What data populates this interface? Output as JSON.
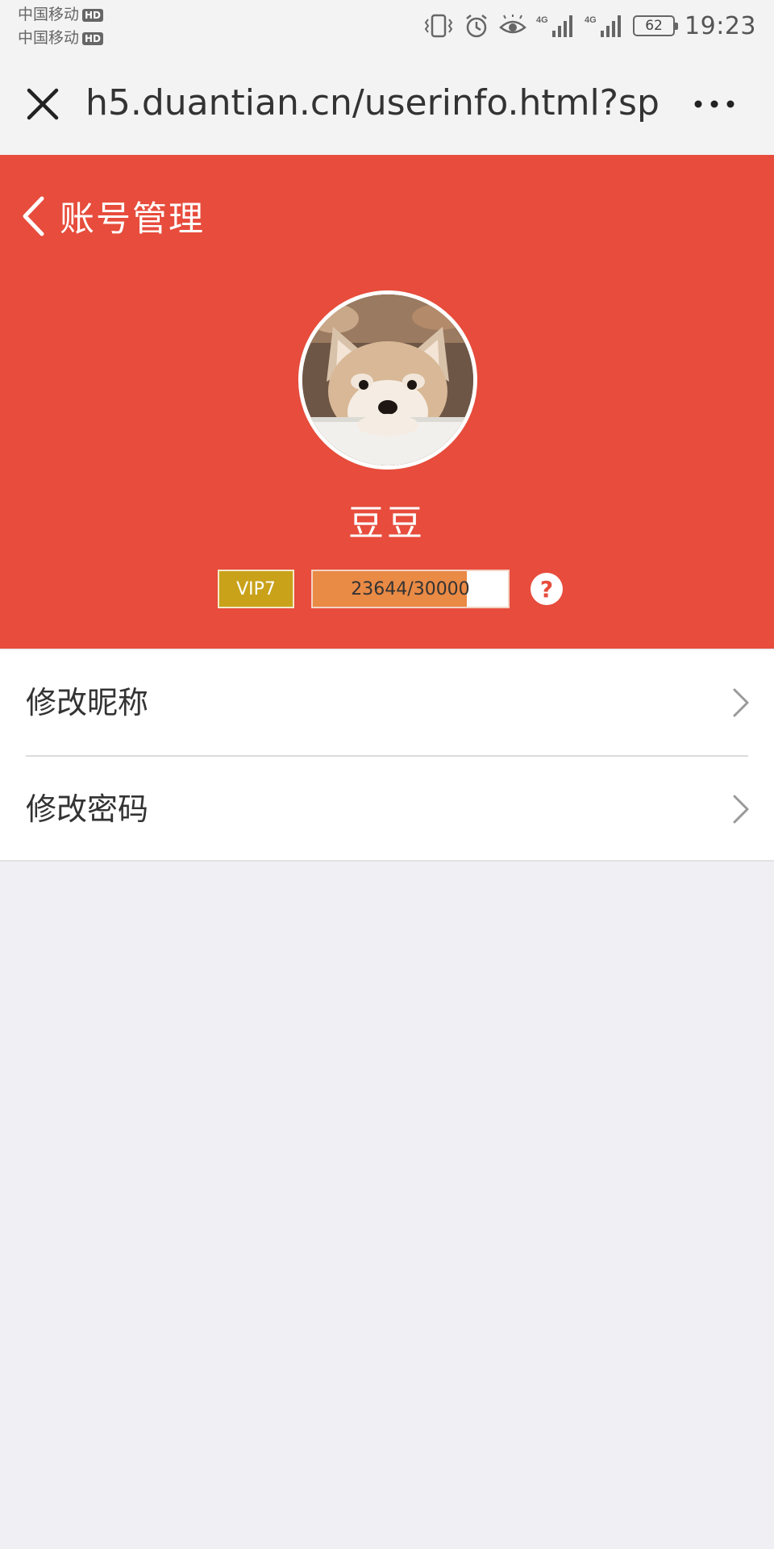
{
  "status_bar": {
    "carriers": [
      {
        "name": "中国移动",
        "badge": "HD"
      },
      {
        "name": "中国移动",
        "badge": "HD"
      }
    ],
    "icons": [
      "vibrate-icon",
      "alarm-icon",
      "eye-comfort-icon",
      "signal-4g-icon",
      "signal-4g-icon",
      "battery-icon"
    ],
    "battery_level": "62",
    "time": "19:23"
  },
  "browser": {
    "url": "h5.duantian.cn/userinfo.html?spi…",
    "close_icon": "close-icon",
    "more_icon": "more-icon"
  },
  "header": {
    "title": "账号管理",
    "back_icon": "chevron-left-icon",
    "background_color": "#e74c3c"
  },
  "profile": {
    "avatar": "avatar (shiba inu puppy photo)",
    "username": "豆豆",
    "vip_level": "VIP7",
    "vip_color": "#c9a21a",
    "exp_text": "23644/30000",
    "exp_current": 23644,
    "exp_max": 30000,
    "exp_color": "#e98a45",
    "help_label": "?"
  },
  "menu": {
    "items": [
      {
        "label": "修改昵称",
        "icon": "chevron-right-icon"
      },
      {
        "label": "修改密码",
        "icon": "chevron-right-icon"
      }
    ]
  }
}
